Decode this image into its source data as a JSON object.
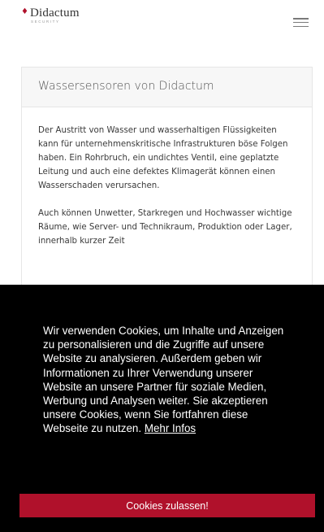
{
  "header": {
    "logo_mark": "♦",
    "logo_name": "Didactum",
    "logo_sub": "SECURITY"
  },
  "card": {
    "title": "Wassersensoren von Didactum",
    "paragraph1": "Der Austritt von Wasser und wasserhaltigen Flüssigkeiten kann für unternehmenskritische Infrastrukturen böse Folgen haben. Ein Rohrbruch, ein undichtes Ventil, eine geplatzte Leitung und auch eine defektes Klimagerät können einen Wasserschaden verursachen.",
    "paragraph2": "Auch können Unwetter, Starkregen und Hochwasser wichtige Räume, wie Server- und Technikraum, Produktion oder Lager, innerhalb kurzer Zeit"
  },
  "cookie": {
    "text": "Wir verwenden Cookies, um Inhalte und Anzeigen zu personalisieren und die Zugriffe auf unsere Website zu analysieren. Außerdem geben wir Informationen zu Ihrer Verwendung unserer Website an unsere Partner für soziale Medien, Werbung und Analysen weiter. Sie akzeptieren unsere Cookies, wenn Sie fortfahren diese Webseite zu nutzen.",
    "link": "Mehr Infos",
    "button": "Cookies zulassen!"
  },
  "colors": {
    "brand": "#b0112b",
    "overlay": "#000000"
  }
}
